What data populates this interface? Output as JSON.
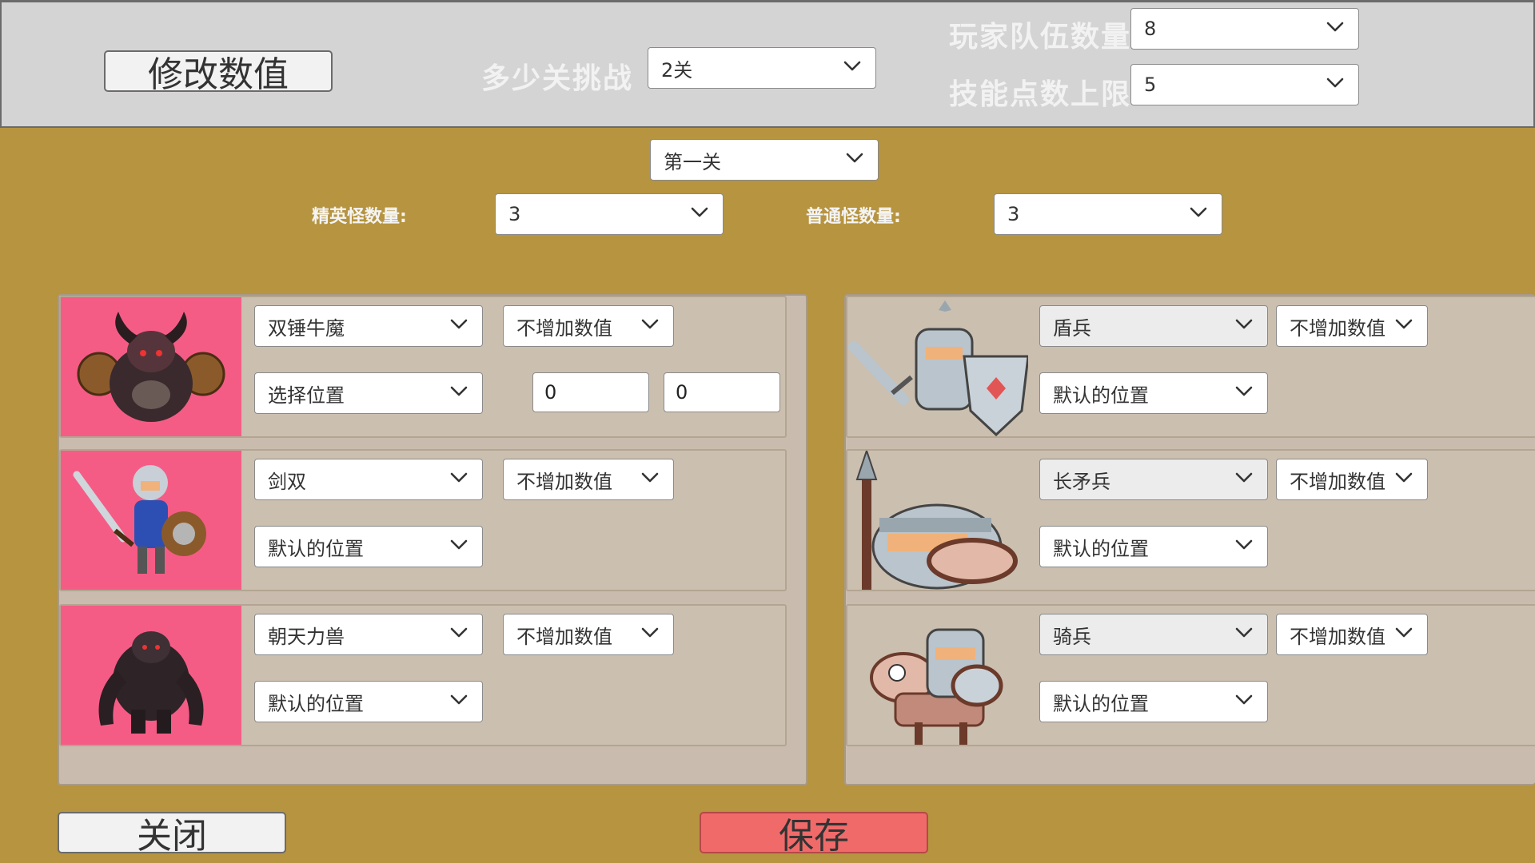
{
  "header": {
    "edit_values_button": "修改数值",
    "stages_label": "多少关挑战",
    "stages_value": "2关",
    "team_count_label": "玩家队伍数量",
    "team_count_value": "8",
    "skill_cap_label": "技能点数上限",
    "skill_cap_value": "5"
  },
  "stage": {
    "current": "第一关",
    "elite_label": "精英怪数量:",
    "elite_value": "3",
    "normal_label": "普通怪数量:",
    "normal_value": "3"
  },
  "elite_monsters": [
    {
      "name": "双锤牛魔",
      "bonus": "不增加数值",
      "position": "选择位置",
      "pos_x": "0",
      "pos_y": "0"
    },
    {
      "name": "剑双",
      "bonus": "不增加数值",
      "position": "默认的位置"
    },
    {
      "name": "朝天力兽",
      "bonus": "不增加数值",
      "position": "默认的位置"
    }
  ],
  "normal_monsters": [
    {
      "name": "盾兵",
      "bonus": "不增加数值",
      "position": "默认的位置"
    },
    {
      "name": "长矛兵",
      "bonus": "不增加数值",
      "position": "默认的位置"
    },
    {
      "name": "骑兵",
      "bonus": "不增加数值",
      "position": "默认的位置"
    }
  ],
  "footer": {
    "close_button": "关闭",
    "save_button": "保存"
  },
  "colors": {
    "background": "#b69440",
    "portrait_bg": "#f55c85",
    "save_button": "#f06a6a"
  }
}
